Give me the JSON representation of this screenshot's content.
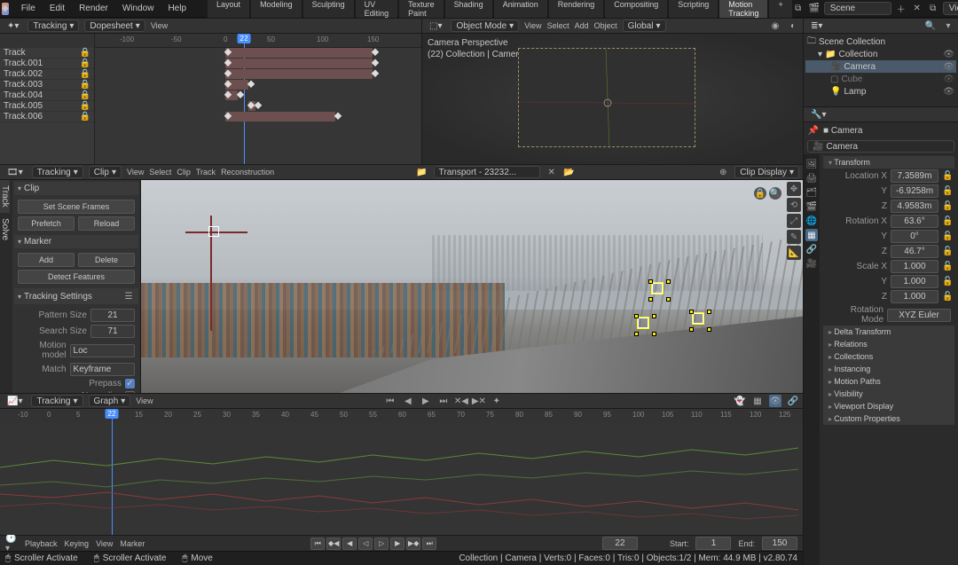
{
  "menu": [
    "File",
    "Edit",
    "Render",
    "Window",
    "Help"
  ],
  "workspace_tabs": [
    "Layout",
    "Modeling",
    "Sculpting",
    "UV Editing",
    "Texture Paint",
    "Shading",
    "Animation",
    "Rendering",
    "Compositing",
    "Scripting",
    "Motion Tracking",
    "+"
  ],
  "workspace_active": "Motion Tracking",
  "scene": {
    "label": "Scene",
    "viewlayer": "View Layer"
  },
  "dope_header": {
    "mode": "Tracking",
    "submode": "Dopesheet",
    "menus": [
      "View"
    ]
  },
  "dope_ruler": [
    -100,
    -50,
    0,
    22,
    50,
    100,
    150
  ],
  "tracks": [
    "Track",
    "Track.001",
    "Track.002",
    "Track.003",
    "Track.004",
    "Track.005",
    "Track.006"
  ],
  "view3d_header": {
    "mode": "Object Mode",
    "menus": [
      "View",
      "Select",
      "Add",
      "Object"
    ],
    "orient": "Global"
  },
  "camera_overlay": {
    "line1": "Camera Perspective",
    "line2": "(22) Collection | Camera"
  },
  "clip_header": {
    "mode": "Tracking",
    "submode": "Clip",
    "menus": [
      "View",
      "Select",
      "Clip",
      "Track",
      "Reconstruction"
    ],
    "clipname": "Transport - 23232...",
    "right": "Clip Display"
  },
  "clip_panel": {
    "clip_title": "Clip",
    "set_scene": "Set Scene Frames",
    "prefetch": "Prefetch",
    "reload": "Reload",
    "marker_title": "Marker",
    "add": "Add",
    "delete": "Delete",
    "detect": "Detect Features",
    "tracking_title": "Tracking Settings",
    "pattern_label": "Pattern Size",
    "pattern_val": "21",
    "search_label": "Search Size",
    "search_val": "71",
    "motion_label": "Motion model",
    "motion_val": "Loc",
    "match_label": "Match",
    "match_val": "Keyframe",
    "prepass": "Prepass",
    "normalize": "Normalize"
  },
  "vtabs": [
    "Track",
    "Solve"
  ],
  "graph_header": {
    "mode": "Tracking",
    "submode": "Graph",
    "menus": [
      "View"
    ]
  },
  "graph_ruler": [
    -10,
    0,
    5,
    10,
    15,
    20,
    25,
    30,
    35,
    40,
    45,
    50,
    55,
    60,
    65,
    70,
    75,
    80,
    85,
    90,
    95,
    100,
    105,
    110,
    115,
    120,
    125
  ],
  "playbar": {
    "menus": [
      "Playback",
      "Keying",
      "View",
      "Marker"
    ],
    "frame": "22",
    "start_lbl": "Start:",
    "start": "1",
    "end_lbl": "End:",
    "end": "150"
  },
  "statusbar": {
    "scroller": "Scroller Activate",
    "scroller2": "Scroller Activate",
    "move": "Move",
    "right": "Collection | Camera | Verts:0 | Faces:0 | Tris:0 | Objects:1/2 | Mem: 44.9 MB | v2.80.74"
  },
  "outliner": {
    "title": "Scene Collection",
    "items": [
      {
        "name": "Collection",
        "indent": 1,
        "icon": "📁"
      },
      {
        "name": "Camera",
        "indent": 2,
        "icon": "🎥",
        "sel": true
      },
      {
        "name": "Cube",
        "indent": 2,
        "icon": "▢"
      },
      {
        "name": "Lamp",
        "indent": 2,
        "icon": "💡"
      }
    ]
  },
  "props": {
    "object": "Camera",
    "transform_title": "Transform",
    "loc_label": "Location X",
    "loc": [
      "7.3589m",
      "-6.9258m",
      "4.9583m"
    ],
    "rot_label": "Rotation X",
    "rot": [
      "63.6°",
      "0°",
      "46.7°"
    ],
    "scale_label": "Scale X",
    "scale": [
      "1.000",
      "1.000",
      "1.000"
    ],
    "rotmode_label": "Rotation Mode",
    "rotmode": "XYZ Euler",
    "delta": "Delta Transform",
    "sections": [
      "Relations",
      "Collections",
      "Instancing",
      "Motion Paths",
      "Visibility",
      "Viewport Display",
      "Custom Properties"
    ]
  },
  "current_frame": 22
}
